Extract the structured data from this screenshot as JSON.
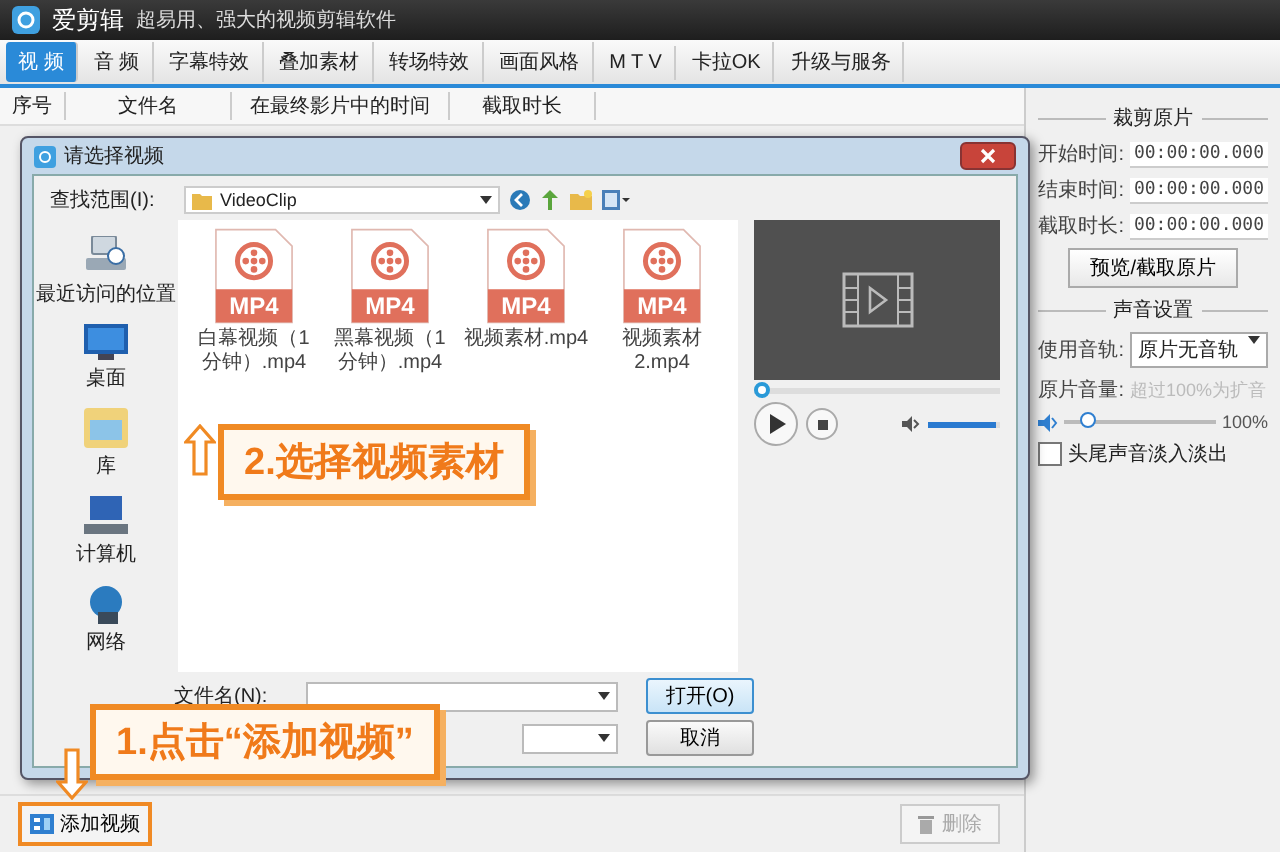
{
  "app": {
    "name": "爱剪辑",
    "slogan": "超易用、强大的视频剪辑软件"
  },
  "tabs": [
    {
      "label": "视 频",
      "selected": true
    },
    {
      "label": "音 频",
      "selected": false
    },
    {
      "label": "字幕特效",
      "selected": false
    },
    {
      "label": "叠加素材",
      "selected": false
    },
    {
      "label": "转场特效",
      "selected": false
    },
    {
      "label": "画面风格",
      "selected": false
    },
    {
      "label": "M T V",
      "selected": false
    },
    {
      "label": "卡拉OK",
      "selected": false
    },
    {
      "label": "升级与服务",
      "selected": false
    }
  ],
  "columns": [
    "序号",
    "文件名",
    "在最终影片中的时间",
    "截取时长"
  ],
  "dialog": {
    "title": "请选择视频",
    "look_in_label": "查找范围(I):",
    "folder": "VideoClip",
    "places": [
      {
        "label": "最近访问的位置",
        "kind": "recent"
      },
      {
        "label": "桌面",
        "kind": "desktop"
      },
      {
        "label": "库",
        "kind": "library"
      },
      {
        "label": "计算机",
        "kind": "computer"
      },
      {
        "label": "网络",
        "kind": "network"
      }
    ],
    "files": [
      {
        "badge": "MP4",
        "name": "白幕视频（1分钟）.mp4"
      },
      {
        "badge": "MP4",
        "name": "黑幕视频（1分钟）.mp4"
      },
      {
        "badge": "MP4",
        "name": "视频素材.mp4"
      },
      {
        "badge": "MP4",
        "name": "视频素材2.mp4"
      }
    ],
    "progress": {
      "level": 0
    },
    "volume": {
      "level": 0.95
    },
    "filename_label": "文件名(N):",
    "open_button": "打开(O)",
    "cancel_button": "取消"
  },
  "annotations": [
    {
      "text": "2.选择视频素材",
      "kind": "up"
    },
    {
      "text": "1.点击“添加视频”",
      "kind": "down"
    }
  ],
  "bottom": {
    "add_button": "添加视频",
    "delete_button": "删除"
  },
  "right_panel": {
    "clip_title": "裁剪原片",
    "times": [
      {
        "label": "开始时间:",
        "value": "00:00:00.000"
      },
      {
        "label": "结束时间:",
        "value": "00:00:00.000"
      },
      {
        "label": "截取时长:",
        "value": "00:00:00.000"
      }
    ],
    "clip_button": "预览/截取原片",
    "audio_title": "声音设置",
    "track_label": "使用音轨:",
    "track_value": "原片无音轨",
    "volume_label": "原片音量:",
    "volume_hint": "超过100%为扩音",
    "volume": {
      "level": 0.15
    },
    "volume_reading": "100%",
    "fade": {
      "label": "头尾声音淡入淡出",
      "checked": false
    }
  }
}
